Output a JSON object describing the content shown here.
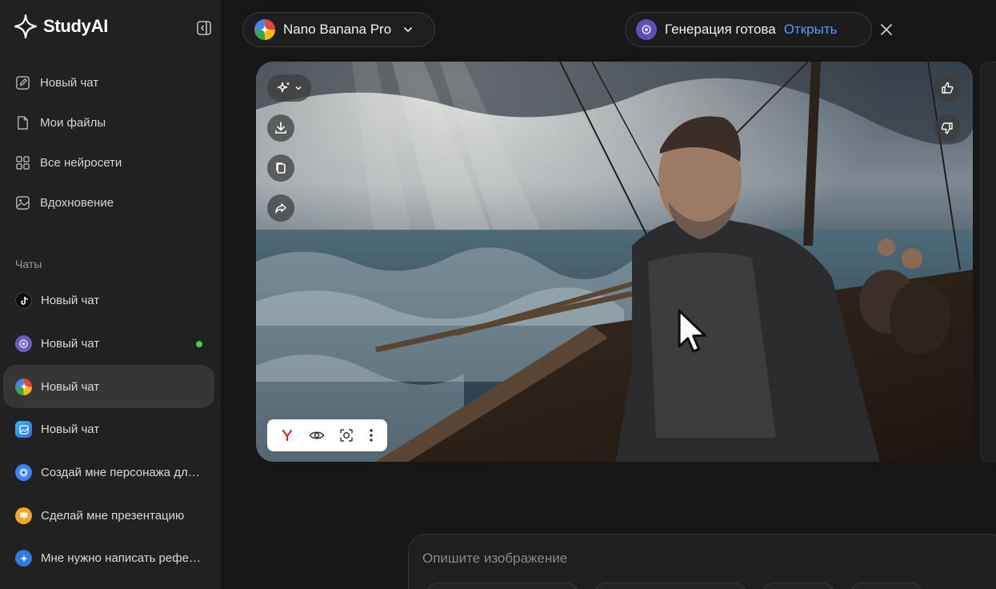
{
  "app": {
    "name": "StudyAI"
  },
  "sidebar": {
    "nav": [
      {
        "label": "Новый чат",
        "icon": "edit-icon"
      },
      {
        "label": "Мои файлы",
        "icon": "file-icon"
      },
      {
        "label": "Все нейросети",
        "icon": "grid-icon"
      },
      {
        "label": "Вдохновение",
        "icon": "gallery-icon"
      }
    ],
    "section_title": "Чаты",
    "chats": [
      {
        "label": "Новый чат",
        "icon": "tiktok-icon"
      },
      {
        "label": "Новый чат",
        "icon": "model-icon",
        "online": true
      },
      {
        "label": "Новый чат",
        "icon": "gemini-icon",
        "active": true
      },
      {
        "label": "Новый чат",
        "icon": "image-app-icon"
      },
      {
        "label": "Создай мне персонажа для игры",
        "icon": "chrome-icon"
      },
      {
        "label": "Сделай мне презентацию",
        "icon": "presentation-icon"
      },
      {
        "label": "Мне нужно написать реферат",
        "icon": "sparkle-icon"
      }
    ]
  },
  "header": {
    "model_name": "Nano Banana Pro",
    "notification_text": "Генерация готова",
    "notification_link": "Открыть"
  },
  "prompt": {
    "placeholder": "Опишите изображение"
  },
  "colors": {
    "accent": "#4e9cff",
    "online": "#3fd24a",
    "sidebar": "#212121",
    "background": "#161616"
  }
}
